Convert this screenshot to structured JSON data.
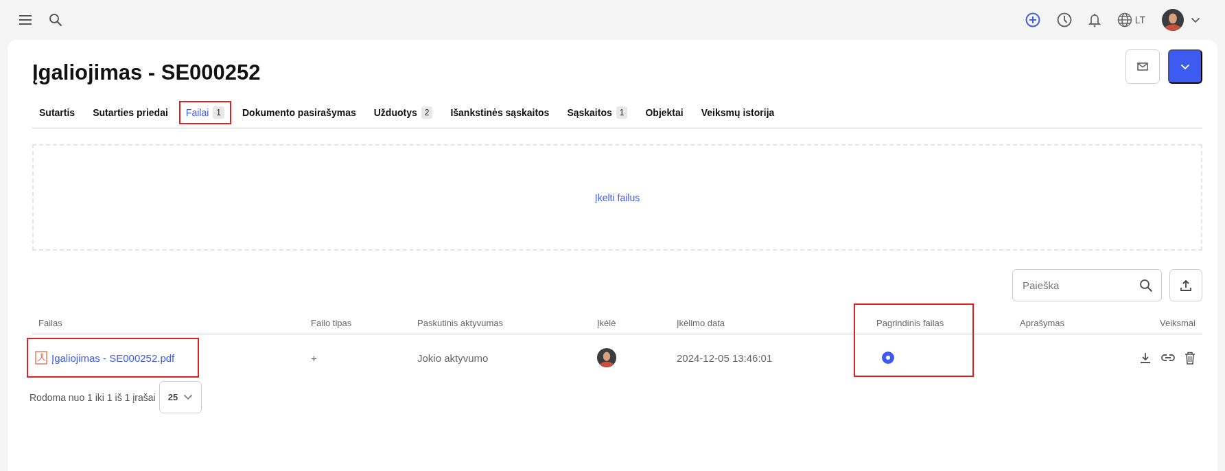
{
  "topbar": {
    "language": "LT"
  },
  "title": "Įgaliojimas - SE000252",
  "tabs": [
    {
      "label": "Sutartis",
      "selected": false,
      "highlighted": false
    },
    {
      "label": "Sutarties priedai",
      "selected": false,
      "highlighted": false
    },
    {
      "label": "Failai",
      "count": "1",
      "selected": true,
      "highlighted": true
    },
    {
      "label": "Dokumento pasirašymas",
      "selected": false,
      "highlighted": false
    },
    {
      "label": "Užduotys",
      "count": "2",
      "selected": false,
      "highlighted": false
    },
    {
      "label": "Išankstinės sąskaitos",
      "selected": false,
      "highlighted": false
    },
    {
      "label": "Sąskaitos",
      "count": "1",
      "selected": false,
      "highlighted": false
    },
    {
      "label": "Objektai",
      "selected": false,
      "highlighted": false
    },
    {
      "label": "Veiksmų istorija",
      "selected": false,
      "highlighted": false
    }
  ],
  "upload_zone": {
    "label": "Įkelti failus"
  },
  "search": {
    "placeholder": "Paieška"
  },
  "table": {
    "columns": [
      {
        "label": "Failas",
        "highlighted": false
      },
      {
        "label": "Failo tipas",
        "highlighted": false
      },
      {
        "label": "Paskutinis aktyvumas",
        "highlighted": false
      },
      {
        "label": "Įkėlė",
        "highlighted": false
      },
      {
        "label": "Įkėlimo data",
        "highlighted": false
      },
      {
        "label": "Pagrindinis failas",
        "highlighted": true
      },
      {
        "label": "Aprašymas",
        "highlighted": false
      },
      {
        "label": "Veiksmai",
        "highlighted": false
      }
    ],
    "rows": [
      {
        "file": "Įgaliojimas - SE000252.pdf",
        "file_highlighted": true,
        "file_type": "+",
        "last_activity": "Jokio aktyvumo",
        "uploaded_on": "2024-12-05 13:46:01",
        "main_file_selected": true
      }
    ]
  },
  "footer": {
    "summary": "Rodoma nuo 1 iki 1 iš 1 įrašai",
    "page_size": "25"
  }
}
